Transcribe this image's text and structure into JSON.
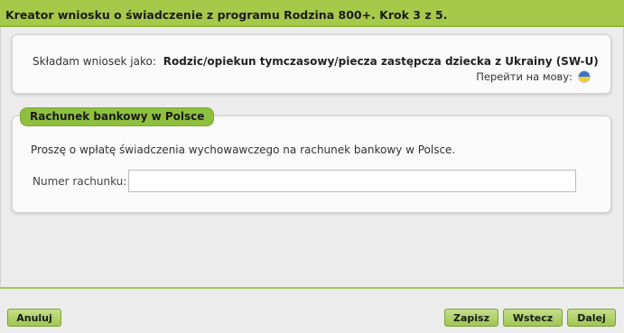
{
  "header": {
    "title": "Kreator wniosku o świadczenie z programu Rodzina 800+. Krok 3 z 5."
  },
  "applicant": {
    "label": "Składam wniosek jako:",
    "value": "Rodzic/opiekun tymczasowy/piecza zastępcza dziecka z Ukrainy (SW-U)"
  },
  "language": {
    "label": "Перейти на мову:",
    "icon": "ukraine-flag-icon",
    "colors": {
      "top": "#3b6fd1",
      "bottom": "#f2cf2a"
    }
  },
  "bank_section": {
    "legend": "Rachunek bankowy w Polsce",
    "info": "Proszę o wpłatę świadczenia wychowawczego na rachunek bankowy w Polsce.",
    "account_label": "Numer rachunku:",
    "account_value": ""
  },
  "footer": {
    "cancel": "Anuluj",
    "save": "Zapisz",
    "back": "Wstecz",
    "next": "Dalej"
  },
  "colors": {
    "accent": "#a6c94a",
    "button": "#9fc653",
    "legend": "#8fbf3f"
  }
}
